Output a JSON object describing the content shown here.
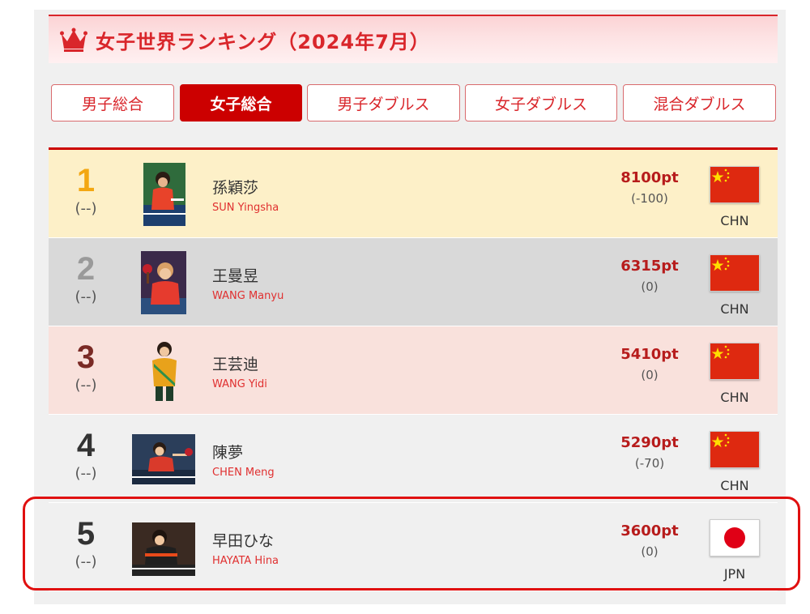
{
  "header": {
    "title": "女子世界ランキング（2024年7月）",
    "icon": "crown-icon",
    "accent": "#d9262b"
  },
  "tabs": [
    {
      "label": "男子総合",
      "active": false
    },
    {
      "label": "女子総合",
      "active": true
    },
    {
      "label": "男子ダブルス",
      "active": false
    },
    {
      "label": "女子ダブルス",
      "active": false
    },
    {
      "label": "混合ダブルス",
      "active": false
    }
  ],
  "rankings": [
    {
      "rank": "1",
      "change": "(--)",
      "name_jp": "孫穎莎",
      "name_en": "SUN Yingsha",
      "points": "8100pt",
      "diff": "(-100)",
      "country": "CHN",
      "flag": "china-flag-icon"
    },
    {
      "rank": "2",
      "change": "(--)",
      "name_jp": "王曼昱",
      "name_en": "WANG Manyu",
      "points": "6315pt",
      "diff": "(0)",
      "country": "CHN",
      "flag": "china-flag-icon"
    },
    {
      "rank": "3",
      "change": "(--)",
      "name_jp": "王芸迪",
      "name_en": "WANG Yidi",
      "points": "5410pt",
      "diff": "(0)",
      "country": "CHN",
      "flag": "china-flag-icon"
    },
    {
      "rank": "4",
      "change": "(--)",
      "name_jp": "陳夢",
      "name_en": "CHEN Meng",
      "points": "5290pt",
      "diff": "(-70)",
      "country": "CHN",
      "flag": "china-flag-icon"
    },
    {
      "rank": "5",
      "change": "(--)",
      "name_jp": "早田ひな",
      "name_en": "HAYATA Hina",
      "points": "3600pt",
      "diff": "(0)",
      "country": "JPN",
      "flag": "japan-flag-icon"
    }
  ],
  "colors": {
    "gold": "#f3a712",
    "silver": "#9a9a9a",
    "bronze": "#7a2a25",
    "points": "#b71c1c",
    "highlight": "#e01010"
  }
}
